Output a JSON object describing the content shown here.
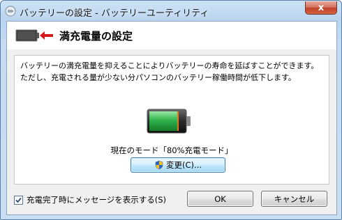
{
  "window": {
    "title": "バッテリーの設定 - バッテリーユーティリティ",
    "close_label": "x"
  },
  "header": {
    "title": "満充電量の設定"
  },
  "content": {
    "description": "バッテリーの満充電量を抑えることによりバッテリーの寿命を延ばすことができます。ただし、充電される量が少ない分パソコンのバッテリー稼働時間が低下します。",
    "mode_text": "現在のモード「80%充電モード」",
    "change_button_label": "変更(C)...",
    "battery_level": 0.8
  },
  "footer": {
    "checkbox_label": "充電完了時にメッセージを表示する(S)",
    "checkbox_checked": true,
    "ok_label": "OK",
    "cancel_label": "キャンセル"
  },
  "icons": {
    "app": "battery-settings-icon",
    "header": "battery-arrow-icon",
    "change": "uac-shield-icon"
  },
  "colors": {
    "battery_fill": "#2fb34a",
    "battery_limit_marker": "#e07820",
    "close_button": "#c8462e"
  }
}
